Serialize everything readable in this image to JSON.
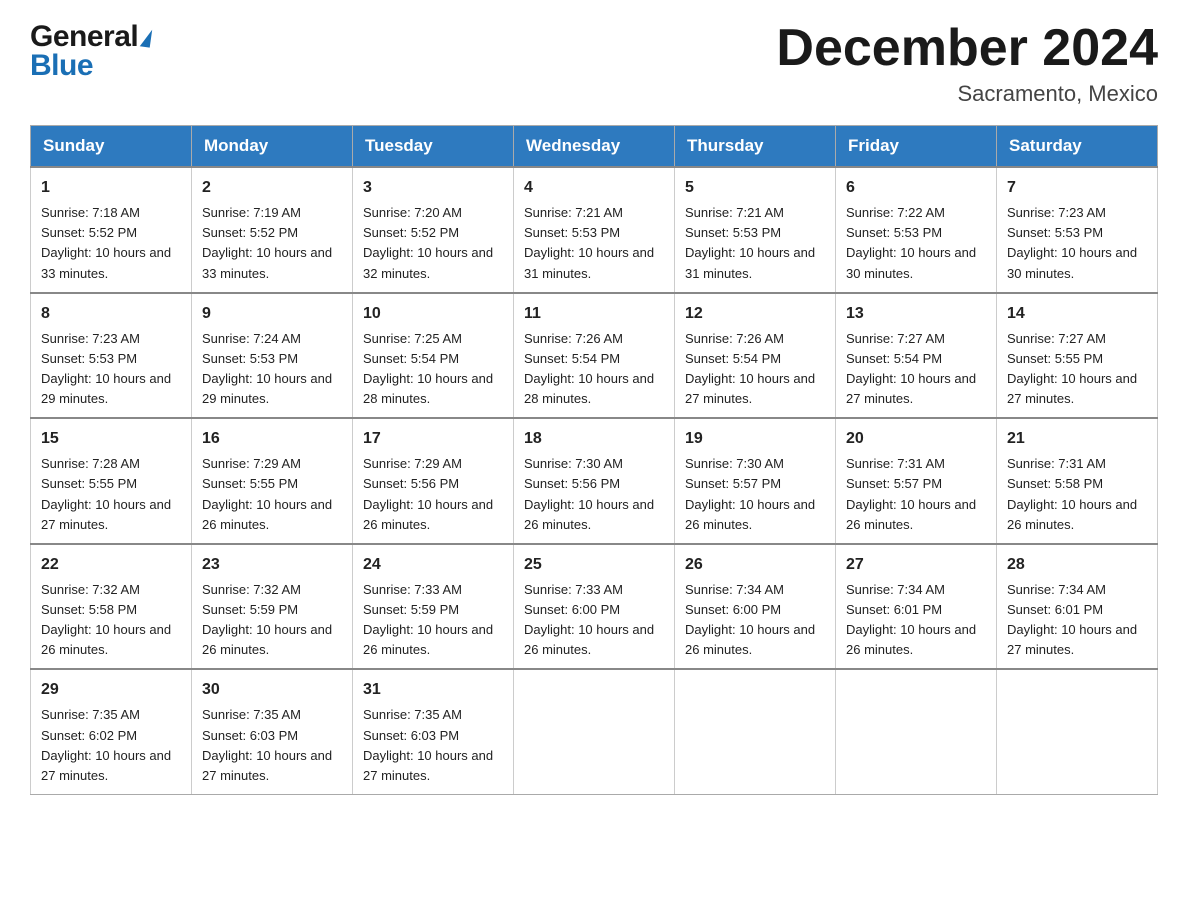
{
  "header": {
    "logo": {
      "general": "General",
      "blue": "Blue"
    },
    "title": "December 2024",
    "location": "Sacramento, Mexico"
  },
  "calendar": {
    "days": [
      "Sunday",
      "Monday",
      "Tuesday",
      "Wednesday",
      "Thursday",
      "Friday",
      "Saturday"
    ],
    "weeks": [
      [
        {
          "day": "1",
          "sunrise": "7:18 AM",
          "sunset": "5:52 PM",
          "daylight": "10 hours and 33 minutes."
        },
        {
          "day": "2",
          "sunrise": "7:19 AM",
          "sunset": "5:52 PM",
          "daylight": "10 hours and 33 minutes."
        },
        {
          "day": "3",
          "sunrise": "7:20 AM",
          "sunset": "5:52 PM",
          "daylight": "10 hours and 32 minutes."
        },
        {
          "day": "4",
          "sunrise": "7:21 AM",
          "sunset": "5:53 PM",
          "daylight": "10 hours and 31 minutes."
        },
        {
          "day": "5",
          "sunrise": "7:21 AM",
          "sunset": "5:53 PM",
          "daylight": "10 hours and 31 minutes."
        },
        {
          "day": "6",
          "sunrise": "7:22 AM",
          "sunset": "5:53 PM",
          "daylight": "10 hours and 30 minutes."
        },
        {
          "day": "7",
          "sunrise": "7:23 AM",
          "sunset": "5:53 PM",
          "daylight": "10 hours and 30 minutes."
        }
      ],
      [
        {
          "day": "8",
          "sunrise": "7:23 AM",
          "sunset": "5:53 PM",
          "daylight": "10 hours and 29 minutes."
        },
        {
          "day": "9",
          "sunrise": "7:24 AM",
          "sunset": "5:53 PM",
          "daylight": "10 hours and 29 minutes."
        },
        {
          "day": "10",
          "sunrise": "7:25 AM",
          "sunset": "5:54 PM",
          "daylight": "10 hours and 28 minutes."
        },
        {
          "day": "11",
          "sunrise": "7:26 AM",
          "sunset": "5:54 PM",
          "daylight": "10 hours and 28 minutes."
        },
        {
          "day": "12",
          "sunrise": "7:26 AM",
          "sunset": "5:54 PM",
          "daylight": "10 hours and 27 minutes."
        },
        {
          "day": "13",
          "sunrise": "7:27 AM",
          "sunset": "5:54 PM",
          "daylight": "10 hours and 27 minutes."
        },
        {
          "day": "14",
          "sunrise": "7:27 AM",
          "sunset": "5:55 PM",
          "daylight": "10 hours and 27 minutes."
        }
      ],
      [
        {
          "day": "15",
          "sunrise": "7:28 AM",
          "sunset": "5:55 PM",
          "daylight": "10 hours and 27 minutes."
        },
        {
          "day": "16",
          "sunrise": "7:29 AM",
          "sunset": "5:55 PM",
          "daylight": "10 hours and 26 minutes."
        },
        {
          "day": "17",
          "sunrise": "7:29 AM",
          "sunset": "5:56 PM",
          "daylight": "10 hours and 26 minutes."
        },
        {
          "day": "18",
          "sunrise": "7:30 AM",
          "sunset": "5:56 PM",
          "daylight": "10 hours and 26 minutes."
        },
        {
          "day": "19",
          "sunrise": "7:30 AM",
          "sunset": "5:57 PM",
          "daylight": "10 hours and 26 minutes."
        },
        {
          "day": "20",
          "sunrise": "7:31 AM",
          "sunset": "5:57 PM",
          "daylight": "10 hours and 26 minutes."
        },
        {
          "day": "21",
          "sunrise": "7:31 AM",
          "sunset": "5:58 PM",
          "daylight": "10 hours and 26 minutes."
        }
      ],
      [
        {
          "day": "22",
          "sunrise": "7:32 AM",
          "sunset": "5:58 PM",
          "daylight": "10 hours and 26 minutes."
        },
        {
          "day": "23",
          "sunrise": "7:32 AM",
          "sunset": "5:59 PM",
          "daylight": "10 hours and 26 minutes."
        },
        {
          "day": "24",
          "sunrise": "7:33 AM",
          "sunset": "5:59 PM",
          "daylight": "10 hours and 26 minutes."
        },
        {
          "day": "25",
          "sunrise": "7:33 AM",
          "sunset": "6:00 PM",
          "daylight": "10 hours and 26 minutes."
        },
        {
          "day": "26",
          "sunrise": "7:34 AM",
          "sunset": "6:00 PM",
          "daylight": "10 hours and 26 minutes."
        },
        {
          "day": "27",
          "sunrise": "7:34 AM",
          "sunset": "6:01 PM",
          "daylight": "10 hours and 26 minutes."
        },
        {
          "day": "28",
          "sunrise": "7:34 AM",
          "sunset": "6:01 PM",
          "daylight": "10 hours and 27 minutes."
        }
      ],
      [
        {
          "day": "29",
          "sunrise": "7:35 AM",
          "sunset": "6:02 PM",
          "daylight": "10 hours and 27 minutes."
        },
        {
          "day": "30",
          "sunrise": "7:35 AM",
          "sunset": "6:03 PM",
          "daylight": "10 hours and 27 minutes."
        },
        {
          "day": "31",
          "sunrise": "7:35 AM",
          "sunset": "6:03 PM",
          "daylight": "10 hours and 27 minutes."
        },
        null,
        null,
        null,
        null
      ]
    ]
  }
}
